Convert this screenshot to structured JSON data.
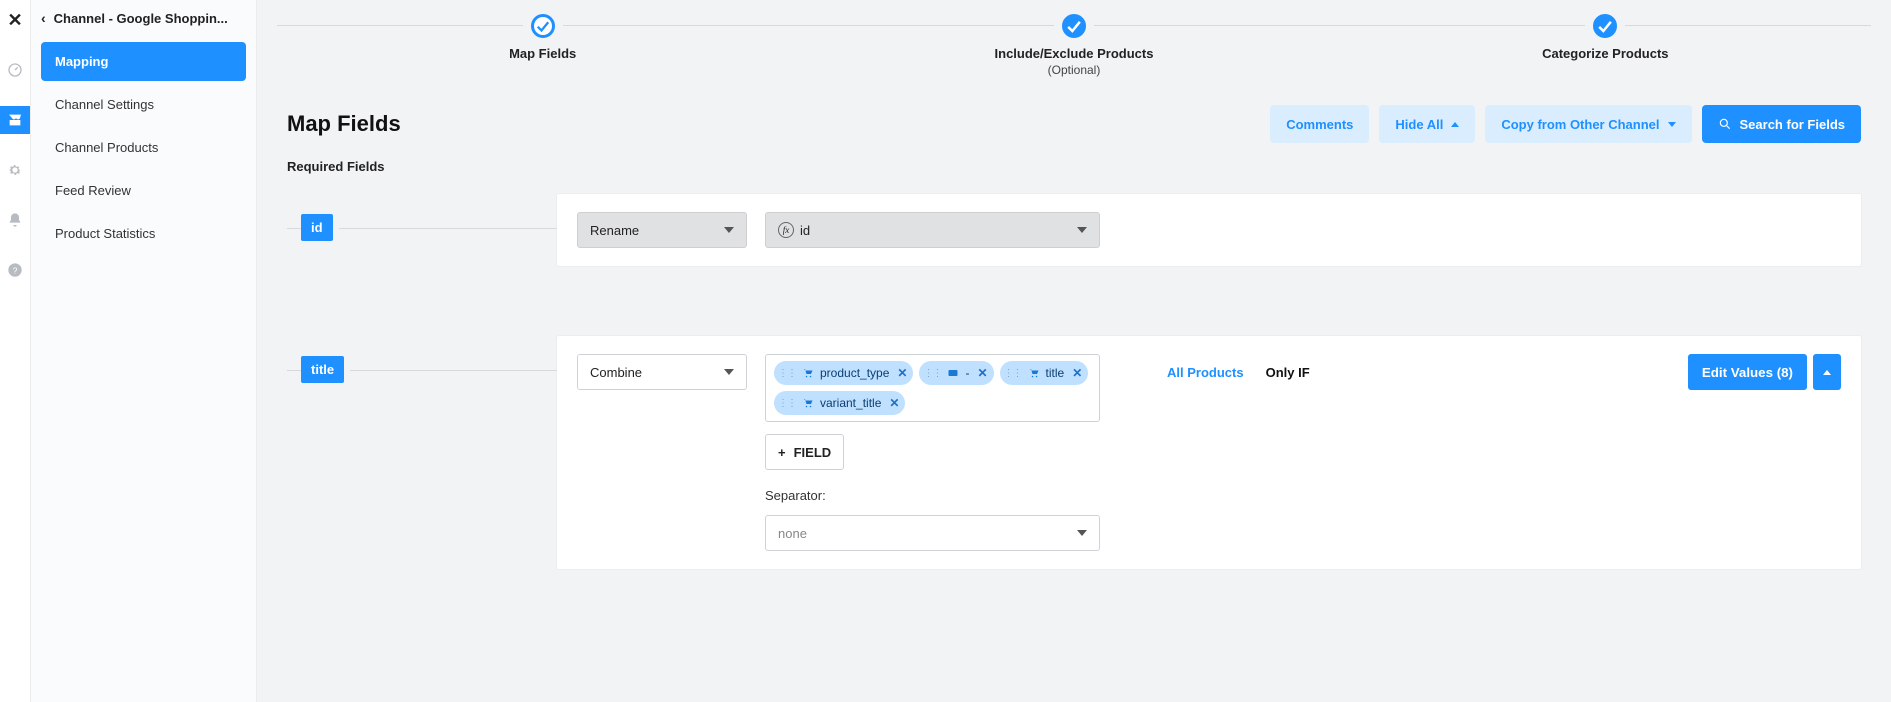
{
  "colors": {
    "accent": "#1e90ff"
  },
  "rail": {
    "close": "✕",
    "items": [
      "dashboard",
      "store",
      "settings",
      "notifications",
      "help"
    ],
    "activeIndex": 1
  },
  "sidebar": {
    "back_icon": "‹",
    "title": "Channel - Google Shoppin...",
    "items": [
      {
        "label": "Mapping"
      },
      {
        "label": "Channel Settings"
      },
      {
        "label": "Channel Products"
      },
      {
        "label": "Feed Review"
      },
      {
        "label": "Product Statistics"
      }
    ],
    "activeIndex": 0
  },
  "stepper": {
    "steps": [
      {
        "label": "Map Fields",
        "sub": "",
        "state": "current"
      },
      {
        "label": "Include/Exclude Products",
        "sub": "(Optional)",
        "state": "done"
      },
      {
        "label": "Categorize Products",
        "sub": "",
        "state": "done"
      }
    ]
  },
  "page": {
    "title": "Map Fields"
  },
  "actions": {
    "comments": "Comments",
    "hide_all": "Hide All",
    "copy": "Copy from Other Channel",
    "search": "Search for Fields"
  },
  "section": {
    "required": "Required Fields"
  },
  "rows": {
    "id": {
      "tag": "id",
      "op": "Rename",
      "value_prefix": "fx",
      "value": "id"
    },
    "title": {
      "tag": "title",
      "op": "Combine",
      "chips": [
        {
          "icon": "cart",
          "label": "product_type"
        },
        {
          "icon": "text",
          "label": "-"
        },
        {
          "icon": "cart",
          "label": "title"
        },
        {
          "icon": "cart",
          "label": "variant_title"
        }
      ],
      "add_field_label": "FIELD",
      "separator_label": "Separator:",
      "separator_value": "none",
      "tabs": {
        "all": "All Products",
        "only_if": "Only IF",
        "activeIndex": 0
      },
      "edit_values": "Edit Values (8)"
    }
  }
}
